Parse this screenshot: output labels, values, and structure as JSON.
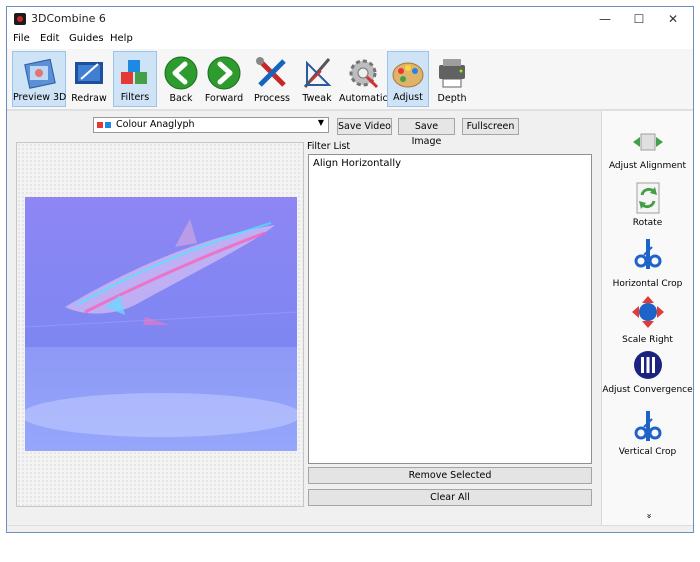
{
  "window": {
    "title": "3DCombine 6"
  },
  "window_controls": {
    "minimize": "—",
    "maximize": "☐",
    "close": "✕"
  },
  "menu": [
    "File",
    "Edit",
    "Guides",
    "Help"
  ],
  "toolbar": [
    {
      "label": "Preview 3D",
      "icon": "preview-3d-icon",
      "active": true
    },
    {
      "label": "Redraw",
      "icon": "redraw-icon",
      "active": false
    },
    {
      "label": "Filters",
      "icon": "filters-icon",
      "active": true
    },
    {
      "label": "Back",
      "icon": "back-arrow-icon",
      "active": false
    },
    {
      "label": "Forward",
      "icon": "forward-arrow-icon",
      "active": false
    },
    {
      "label": "Process",
      "icon": "process-tools-icon",
      "active": false
    },
    {
      "label": "Tweak",
      "icon": "tweak-icon",
      "active": false
    },
    {
      "label": "Automatic",
      "icon": "automatic-gear-icon",
      "active": false
    },
    {
      "label": "Adjust",
      "icon": "adjust-palette-icon",
      "active": true
    },
    {
      "label": "Depth",
      "icon": "depth-icon",
      "active": false
    }
  ],
  "mode_select": {
    "value": "Colour Anaglyph"
  },
  "buttons": {
    "save_video": "Save Video",
    "save_image": "Save Image",
    "fullscreen": "Fullscreen"
  },
  "filter_list": {
    "label": "Filter List",
    "items": [
      "Align Horizontally"
    ]
  },
  "list_buttons": {
    "remove_selected": "Remove Selected",
    "clear_all": "Clear All"
  },
  "right_panel": [
    {
      "label": "Adjust Alignment",
      "icon": "adjust-alignment-icon"
    },
    {
      "label": "Rotate",
      "icon": "rotate-icon"
    },
    {
      "label": "Horizontal Crop",
      "icon": "horizontal-crop-icon"
    },
    {
      "label": "Scale Right",
      "icon": "scale-right-icon"
    },
    {
      "label": "Adjust Convergence",
      "icon": "adjust-convergence-icon"
    },
    {
      "label": "Vertical Crop",
      "icon": "vertical-crop-icon"
    }
  ],
  "more_indicator": "»"
}
